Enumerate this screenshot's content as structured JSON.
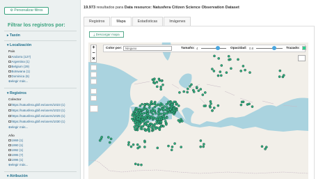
{
  "sidebar": {
    "customize_button": "Personalizar filtros",
    "title": "Filtrar los registros por:",
    "sections": {
      "taxon": "Taxón",
      "localizacion": "Localización",
      "registros": "Registros",
      "atribucion": "Atribución"
    },
    "pais_label": "País",
    "pais_items": [
      "Andorra (127)",
      "Argentina (1)",
      "Belgium (29)",
      "Botswana (1)",
      "Dominica (6)"
    ],
    "pais_more": "elegir más...",
    "colector_label": "Colector",
    "colector_items": [
      "https://natusfera.gbif.es/users/1023 (1)",
      "https://natusfera.gbif.es/users/1023 (1)",
      "https://natusfera.gbif.es/users/1025 (1)",
      "https://natusfera.gbif.es/users/1030 (1)"
    ],
    "colector_more": "elegir más...",
    "ano_label": "Año",
    "ano_items": [
      "1969 (1)",
      "1990 (1)",
      "1992 (1)",
      "1995 (7)",
      "1996 (1)"
    ],
    "ano_more": "elegir más..."
  },
  "header": {
    "count": "19.973",
    "count_suffix": " resultados para ",
    "resource_label": "Data resource: Natusfera Citizen Science Observation Dataset"
  },
  "tabs": [
    "Registros",
    "Mapa",
    "Estadísticas",
    "Imágenes"
  ],
  "active_tab": "Mapa",
  "download_button": "Descargar mapa",
  "map": {
    "zoom_in": "+",
    "zoom_out": "−",
    "color_label": "Color por:",
    "color_value": "Ninguno",
    "size_label": "Tamaño:",
    "size_value": "4",
    "opacity_label": "Opacidad:",
    "opacity_value": "0.8",
    "outline_label": "Trazado:",
    "point_color": "#2fae7e",
    "point_outline": "#1a3d33",
    "water_color": "#aad3df",
    "land_color": "#f2efe9"
  }
}
